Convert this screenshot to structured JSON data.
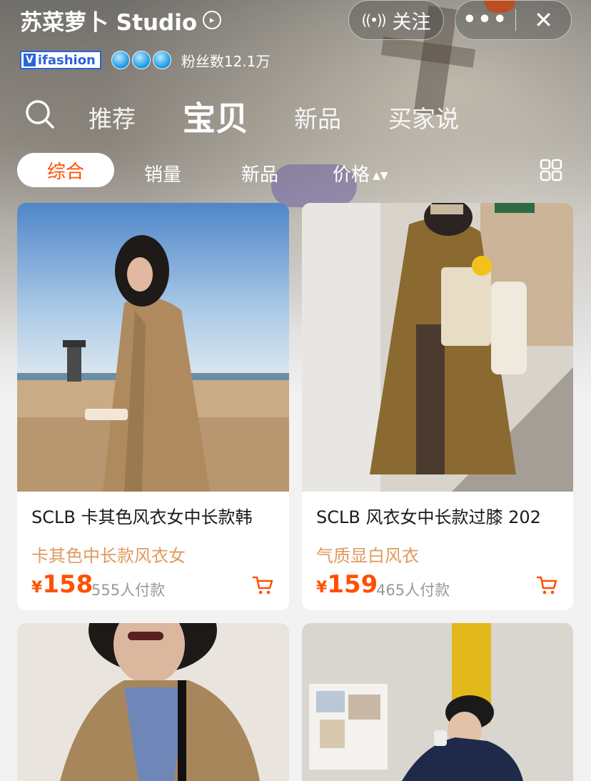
{
  "shop": {
    "name": "苏菜萝卜 Studio",
    "follow_label": "关注",
    "badge_label": "ifashion",
    "fans": "粉丝数12.1万"
  },
  "nav": {
    "tabs": [
      "推荐",
      "宝贝",
      "新品",
      "买家说"
    ],
    "active": "宝贝"
  },
  "filter": {
    "items": [
      "综合",
      "销量",
      "新品",
      "价格"
    ],
    "active": "综合"
  },
  "products": [
    {
      "title": "SCLB 卡其色风衣女中长款韩",
      "subtitle": "卡其色中长款风衣女",
      "currency": "¥",
      "price": "158",
      "sold": "555人付款"
    },
    {
      "title": "SCLB 风衣女中长款过膝 202",
      "subtitle": "气质显白风衣",
      "currency": "¥",
      "price": "159",
      "sold": "465人付款"
    }
  ],
  "colors": {
    "accent": "#ff5000",
    "subtitle": "#e09a5e",
    "badge_blue": "#2d63d8"
  }
}
